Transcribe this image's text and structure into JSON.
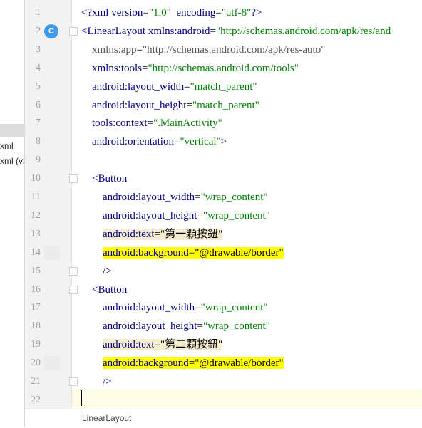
{
  "project_panel": {
    "items": [
      "xml",
      "xml (v2"
    ]
  },
  "editor": {
    "lines": [
      {
        "n": "1",
        "parts": [
          [
            "tag",
            "<?xml "
          ],
          [
            "attr",
            "version"
          ],
          [
            "plain",
            "="
          ],
          [
            "val",
            "\"1.0\""
          ],
          [
            "plain",
            "  "
          ],
          [
            "attr",
            "encoding"
          ],
          [
            "plain",
            "="
          ],
          [
            "val",
            "\"utf-8\""
          ],
          [
            "tag",
            "?>"
          ]
        ]
      },
      {
        "n": "2",
        "parts": [
          [
            "tag",
            "<LinearLayout "
          ],
          [
            "attr",
            "xmlns:android"
          ],
          [
            "plain",
            "="
          ],
          [
            "val",
            "\"http://schemas.android.com/apk/res/and"
          ]
        ]
      },
      {
        "n": "3",
        "parts": [
          [
            "plain",
            "    "
          ],
          [
            "attr-gray",
            "xmlns:app"
          ],
          [
            "plain",
            "="
          ],
          [
            "val-gray",
            "\"http://schemas.android.com/apk/res-auto\""
          ]
        ]
      },
      {
        "n": "4",
        "parts": [
          [
            "plain",
            "    "
          ],
          [
            "attr",
            "xmlns:tools"
          ],
          [
            "plain",
            "="
          ],
          [
            "val",
            "\"http://schemas.android.com/tools\""
          ]
        ]
      },
      {
        "n": "5",
        "parts": [
          [
            "plain",
            "    "
          ],
          [
            "attr",
            "android:layout_width"
          ],
          [
            "plain",
            "="
          ],
          [
            "val",
            "\"match_parent\""
          ]
        ]
      },
      {
        "n": "6",
        "parts": [
          [
            "plain",
            "    "
          ],
          [
            "attr",
            "android:layout_height"
          ],
          [
            "plain",
            "="
          ],
          [
            "val",
            "\"match_parent\""
          ]
        ]
      },
      {
        "n": "7",
        "parts": [
          [
            "plain",
            "    "
          ],
          [
            "attr",
            "tools:context"
          ],
          [
            "plain",
            "="
          ],
          [
            "val",
            "\".MainActivity\""
          ]
        ]
      },
      {
        "n": "8",
        "parts": [
          [
            "plain",
            "    "
          ],
          [
            "attr",
            "android:orientation"
          ],
          [
            "plain",
            "="
          ],
          [
            "val",
            "\"vertical\""
          ],
          [
            "tag",
            ">"
          ]
        ]
      },
      {
        "n": "9",
        "parts": []
      },
      {
        "n": "10",
        "parts": [
          [
            "plain",
            "    "
          ],
          [
            "tag",
            "<Button"
          ]
        ]
      },
      {
        "n": "11",
        "parts": [
          [
            "plain",
            "        "
          ],
          [
            "attr",
            "android:layout_width"
          ],
          [
            "plain",
            "="
          ],
          [
            "val",
            "\"wrap_content\""
          ]
        ]
      },
      {
        "n": "12",
        "parts": [
          [
            "plain",
            "        "
          ],
          [
            "attr",
            "android:layout_height"
          ],
          [
            "plain",
            "="
          ],
          [
            "val",
            "\"wrap_content\""
          ]
        ]
      },
      {
        "n": "13",
        "parts": [
          [
            "plain",
            "        "
          ],
          [
            "attr-tan",
            "android:text"
          ],
          [
            "plain-tan",
            "="
          ],
          [
            "val-tan",
            "\"第一顆按鈕\""
          ]
        ]
      },
      {
        "n": "14",
        "parts": [
          [
            "plain",
            "        "
          ],
          [
            "attr-yel",
            "android:background"
          ],
          [
            "plain-yel",
            "="
          ],
          [
            "val-yel",
            "\"@drawable/border\""
          ]
        ]
      },
      {
        "n": "15",
        "parts": [
          [
            "plain",
            "        "
          ],
          [
            "tag",
            "/>"
          ]
        ]
      },
      {
        "n": "16",
        "parts": [
          [
            "plain",
            "    "
          ],
          [
            "tag",
            "<Button"
          ]
        ]
      },
      {
        "n": "17",
        "parts": [
          [
            "plain",
            "        "
          ],
          [
            "attr",
            "android:layout_width"
          ],
          [
            "plain",
            "="
          ],
          [
            "val",
            "\"wrap_content\""
          ]
        ]
      },
      {
        "n": "18",
        "parts": [
          [
            "plain",
            "        "
          ],
          [
            "attr",
            "android:layout_height"
          ],
          [
            "plain",
            "="
          ],
          [
            "val",
            "\"wrap_content\""
          ]
        ]
      },
      {
        "n": "19",
        "parts": [
          [
            "plain",
            "        "
          ],
          [
            "attr-tan",
            "android:text"
          ],
          [
            "plain-tan",
            "="
          ],
          [
            "val-tan",
            "\"第二顆按鈕\""
          ]
        ]
      },
      {
        "n": "20",
        "parts": [
          [
            "plain",
            "        "
          ],
          [
            "attr-yel",
            "android:background"
          ],
          [
            "plain-yel",
            "="
          ],
          [
            "val-yel",
            "\"@drawable/border\""
          ]
        ]
      },
      {
        "n": "21",
        "parts": [
          [
            "plain",
            "        "
          ],
          [
            "tag",
            "/>"
          ]
        ]
      },
      {
        "n": "22",
        "parts": []
      }
    ],
    "gutter_badge": "C"
  },
  "status_bar": {
    "breadcrumb": "LinearLayout"
  },
  "colors": {
    "tag": "#000080",
    "attribute": "#000080",
    "value": "#008000",
    "highlight_yellow": "#ffff00",
    "highlight_tan": "#f6ecd0"
  }
}
